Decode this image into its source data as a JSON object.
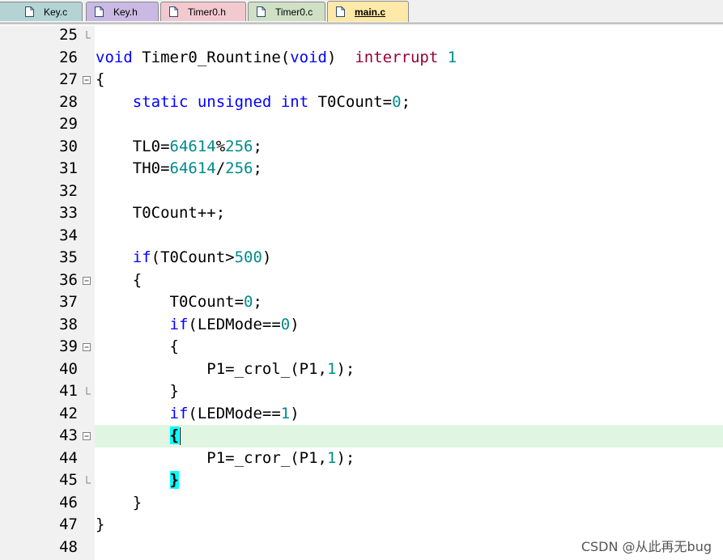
{
  "tabs": [
    {
      "label": "Key.c",
      "color": "#b4d3d3",
      "active": false
    },
    {
      "label": "Key.h",
      "color": "#c9b9e3",
      "active": false
    },
    {
      "label": "Timer0.h",
      "color": "#f2c9cf",
      "active": false
    },
    {
      "label": "Timer0.c",
      "color": "#cfe0c4",
      "active": false
    },
    {
      "label": "main.c",
      "color": "#ffe9a8",
      "active": true
    }
  ],
  "editor": {
    "current_line": 43,
    "line_numbers": [
      "25",
      "26",
      "27",
      "28",
      "29",
      "30",
      "31",
      "32",
      "33",
      "34",
      "35",
      "36",
      "37",
      "38",
      "39",
      "40",
      "41",
      "42",
      "43",
      "44",
      "45",
      "46",
      "47",
      "48"
    ],
    "fold_markers": {
      "25": "end",
      "27": "box",
      "36": "box",
      "39": "box",
      "41": "end",
      "43": "box",
      "45": "end"
    },
    "lines": [
      "",
      "void Timer0_Rountine(void)  interrupt 1",
      "{",
      "    static unsigned int T0Count=0;",
      "",
      "    TL0=64614%256;",
      "    TH0=64614/256;",
      "",
      "    T0Count++;",
      "",
      "    if(T0Count>500)",
      "    {",
      "        T0Count=0;",
      "        if(LEDMode==0)",
      "        {",
      "            P1=_crol_(P1,1);",
      "        }",
      "        if(LEDMode==1)",
      "        {",
      "            P1=_cror_(P1,1);",
      "        }",
      "    }",
      "}",
      ""
    ]
  },
  "watermark": "CSDN @从此再无bug",
  "colors": {
    "keyword": "#0000ff",
    "number": "#008b8b",
    "interrupt": "#990033",
    "current_line_bg": "#e1f5e3",
    "brace_highlight": "#00ffff",
    "gutter_bg": "#f1f1f1"
  }
}
